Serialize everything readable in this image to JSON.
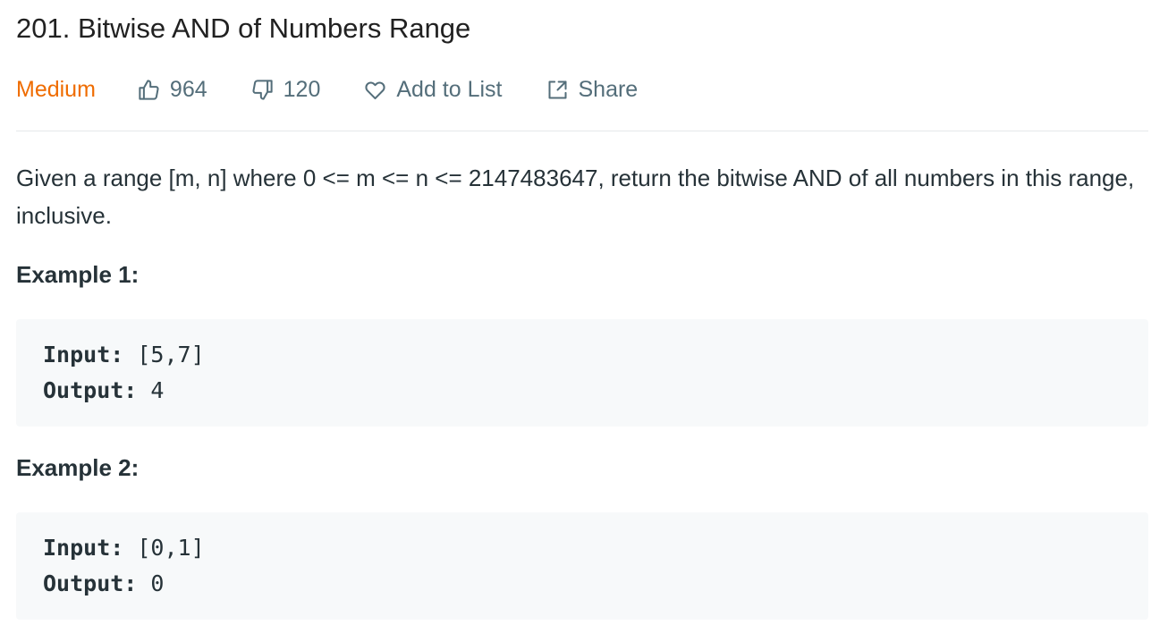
{
  "problem": {
    "title": "201. Bitwise AND of Numbers Range",
    "difficulty": "Medium",
    "likes": "964",
    "dislikes": "120",
    "add_to_list": "Add to List",
    "share": "Share"
  },
  "description": "Given a range [m, n] where 0 <= m <= n <= 2147483647, return the bitwise AND of all numbers in this range, inclusive.",
  "examples": [
    {
      "title": "Example 1:",
      "input_label": "Input:",
      "input_value": " [5,7]",
      "output_label": "Output:",
      "output_value": " 4"
    },
    {
      "title": "Example 2:",
      "input_label": "Input:",
      "input_value": " [0,1]",
      "output_label": "Output:",
      "output_value": " 0"
    }
  ],
  "colors": {
    "difficulty_medium": "#ef6c00",
    "meta_text": "#546e7a",
    "code_background": "#f7f9fa"
  },
  "icons": {
    "likes": "thumbs-up-icon",
    "dislikes": "thumbs-down-icon",
    "add_to_list": "heart-icon",
    "share": "share-icon"
  }
}
